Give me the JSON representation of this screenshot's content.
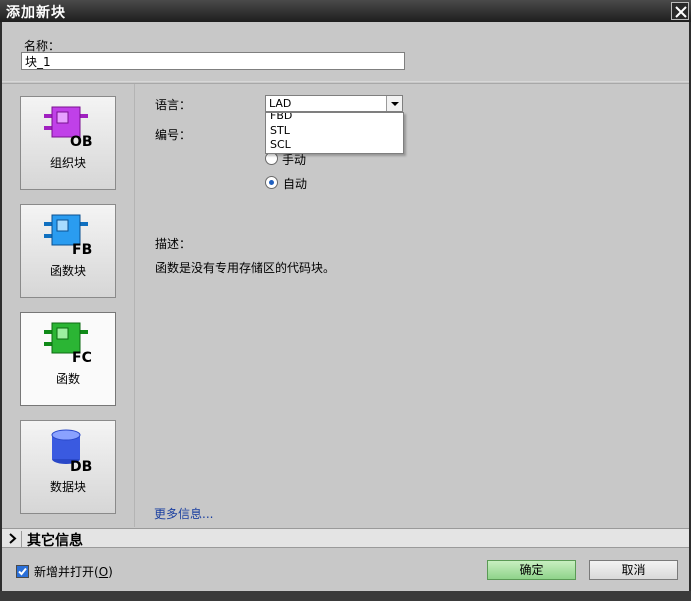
{
  "window": {
    "title": "添加新块"
  },
  "name_field": {
    "label": "名称：",
    "value": "块_1"
  },
  "block_types": [
    {
      "name": "ob",
      "badge": "OB",
      "label": "组织块",
      "color": "#c030e0",
      "selected": false
    },
    {
      "name": "fb",
      "badge": "FB",
      "label": "函数块",
      "color": "#1e90e8",
      "selected": false
    },
    {
      "name": "fc",
      "badge": "FC",
      "label": "函数",
      "color": "#1fb02a",
      "selected": true
    },
    {
      "name": "db",
      "badge": "DB",
      "label": "数据块",
      "color": "#3a5ae0",
      "selected": false
    }
  ],
  "form": {
    "language_label": "语言：",
    "language_value": "LAD",
    "language_options": [
      "FBD",
      "STL",
      "SCL"
    ],
    "number_label": "编号：",
    "radio_manual": "手动",
    "radio_auto": "自动",
    "description_label": "描述：",
    "description_text": "函数是没有专用存储区的代码块。",
    "more_info": "更多信息..."
  },
  "other_info": {
    "label": "其它信息"
  },
  "footer": {
    "open_label": "新增并打开(",
    "open_hotkey": "O",
    "open_suffix": ")",
    "ok": "确定",
    "cancel": "取消"
  }
}
